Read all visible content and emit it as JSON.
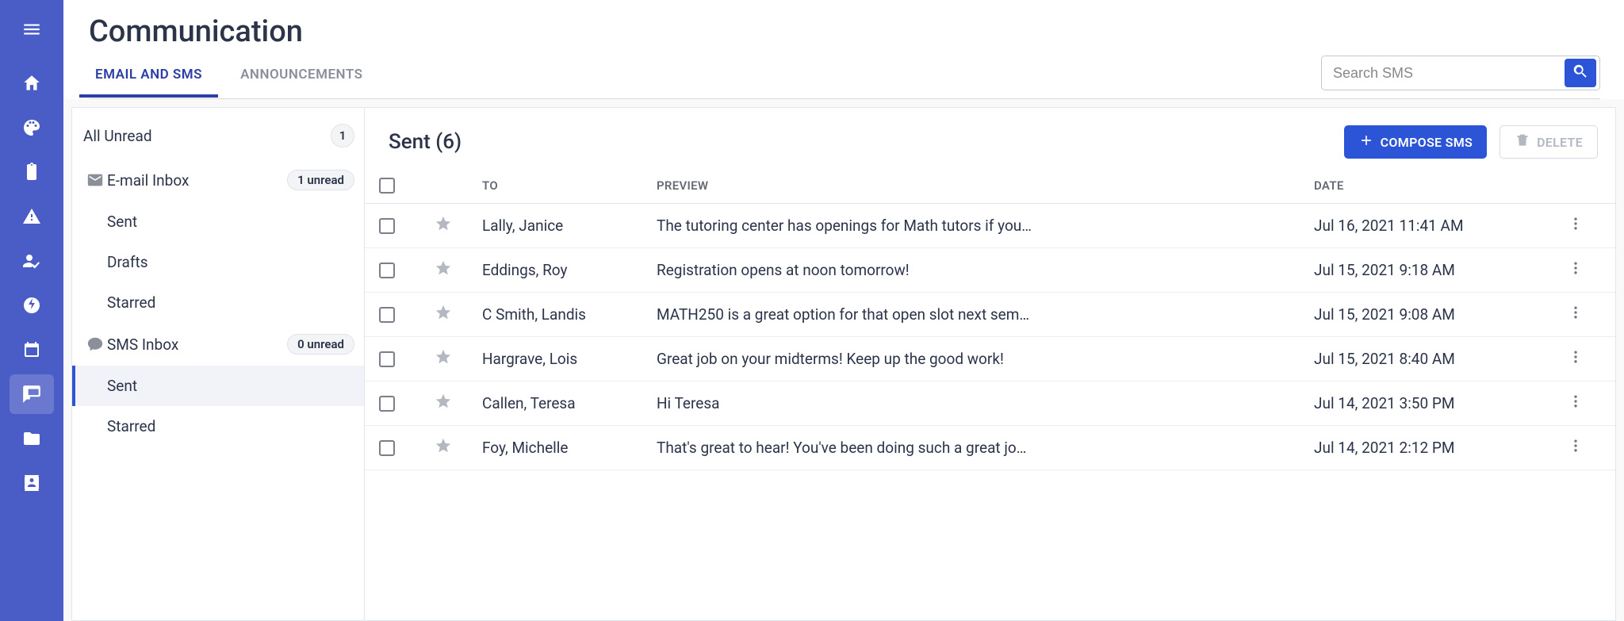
{
  "page_title": "Communication",
  "tabs": [
    {
      "label": "EMAIL AND SMS",
      "active": true
    },
    {
      "label": "ANNOUNCEMENTS",
      "active": false
    }
  ],
  "search": {
    "placeholder": "Search SMS"
  },
  "sidebar": {
    "all_unread": {
      "label": "All Unread",
      "count": "1"
    },
    "email_inbox": {
      "label": "E-mail Inbox",
      "badge": "1 unread"
    },
    "email_sub": [
      {
        "label": "Sent"
      },
      {
        "label": "Drafts"
      },
      {
        "label": "Starred"
      }
    ],
    "sms_inbox": {
      "label": "SMS Inbox",
      "badge": "0 unread"
    },
    "sms_sub": [
      {
        "label": "Sent",
        "active": true
      },
      {
        "label": "Starred"
      }
    ]
  },
  "panel": {
    "title": "Sent (6)",
    "compose_label": "COMPOSE SMS",
    "delete_label": "DELETE",
    "columns": {
      "to": "TO",
      "preview": "PREVIEW",
      "date": "DATE"
    },
    "rows": [
      {
        "to": "Lally, Janice",
        "preview": "The tutoring center has openings for Math tutors if you…",
        "date": "Jul 16, 2021 11:41 AM"
      },
      {
        "to": "Eddings, Roy",
        "preview": "Registration opens at noon tomorrow!",
        "date": "Jul 15, 2021 9:18 AM"
      },
      {
        "to": "C Smith, Landis",
        "preview": "MATH250 is a great option for that open slot next sem…",
        "date": "Jul 15, 2021 9:08 AM"
      },
      {
        "to": "Hargrave, Lois",
        "preview": "Great job on your midterms! Keep up the good work!",
        "date": "Jul 15, 2021 8:40 AM"
      },
      {
        "to": "Callen, Teresa",
        "preview": "Hi Teresa",
        "date": "Jul 14, 2021 3:50 PM"
      },
      {
        "to": "Foy, Michelle",
        "preview": "That's great to hear! You've been doing such a great jo…",
        "date": "Jul 14, 2021 2:12 PM"
      }
    ]
  }
}
